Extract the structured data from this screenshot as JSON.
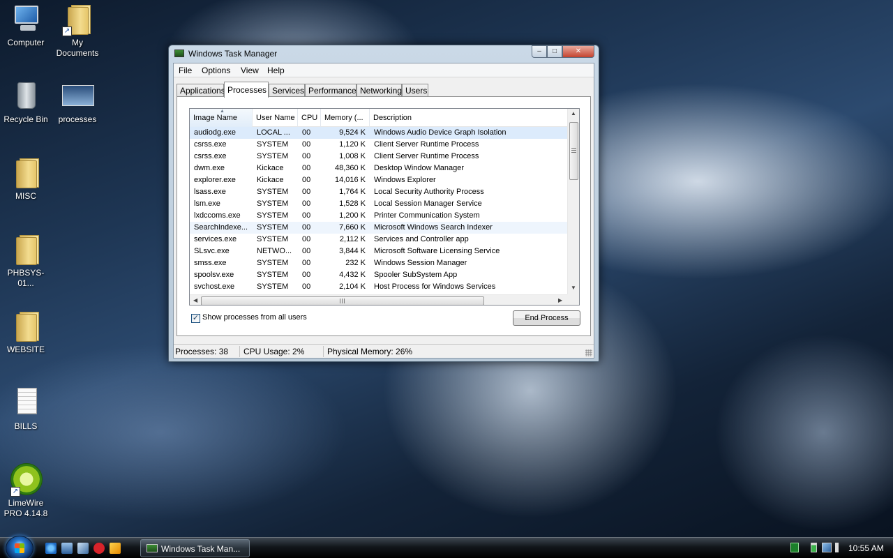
{
  "desktop": {
    "icons": [
      {
        "label": "Computer"
      },
      {
        "label": "My Documents"
      },
      {
        "label": "Recycle Bin"
      },
      {
        "label": "processes"
      },
      {
        "label": "MISC"
      },
      {
        "label": "PHBSYS-01..."
      },
      {
        "label": "WEBSITE"
      },
      {
        "label": "BILLS"
      },
      {
        "label": "LimeWire PRO 4.14.8"
      }
    ]
  },
  "window": {
    "title": "Windows Task Manager",
    "controls": {
      "minimize": "–",
      "maximize": "□",
      "close": "✕"
    },
    "menu": [
      "File",
      "Options",
      "View",
      "Help"
    ],
    "tabs": [
      "Applications",
      "Processes",
      "Services",
      "Performance",
      "Networking",
      "Users"
    ],
    "active_tab": "Processes",
    "columns": [
      "Image Name",
      "User Name",
      "CPU",
      "Memory (...",
      "Description"
    ],
    "sorted_column": "Image Name",
    "processes": [
      {
        "image": "audiodg.exe",
        "user": "LOCAL ...",
        "cpu": "00",
        "memory": "9,524 K",
        "description": "Windows Audio Device Graph Isolation"
      },
      {
        "image": "csrss.exe",
        "user": "SYSTEM",
        "cpu": "00",
        "memory": "1,120 K",
        "description": "Client Server Runtime Process"
      },
      {
        "image": "csrss.exe",
        "user": "SYSTEM",
        "cpu": "00",
        "memory": "1,008 K",
        "description": "Client Server Runtime Process"
      },
      {
        "image": "dwm.exe",
        "user": "Kickace",
        "cpu": "00",
        "memory": "48,360 K",
        "description": "Desktop Window Manager"
      },
      {
        "image": "explorer.exe",
        "user": "Kickace",
        "cpu": "00",
        "memory": "14,016 K",
        "description": "Windows Explorer"
      },
      {
        "image": "lsass.exe",
        "user": "SYSTEM",
        "cpu": "00",
        "memory": "1,764 K",
        "description": "Local Security Authority Process"
      },
      {
        "image": "lsm.exe",
        "user": "SYSTEM",
        "cpu": "00",
        "memory": "1,528 K",
        "description": "Local Session Manager Service"
      },
      {
        "image": "lxdccoms.exe",
        "user": "SYSTEM",
        "cpu": "00",
        "memory": "1,200 K",
        "description": "Printer Communication System"
      },
      {
        "image": "SearchIndexe...",
        "user": "SYSTEM",
        "cpu": "00",
        "memory": "7,660 K",
        "description": "Microsoft Windows Search Indexer"
      },
      {
        "image": "services.exe",
        "user": "SYSTEM",
        "cpu": "00",
        "memory": "2,112 K",
        "description": "Services and Controller app"
      },
      {
        "image": "SLsvc.exe",
        "user": "NETWO...",
        "cpu": "00",
        "memory": "3,844 K",
        "description": "Microsoft Software Licensing Service"
      },
      {
        "image": "smss.exe",
        "user": "SYSTEM",
        "cpu": "00",
        "memory": "232 K",
        "description": "Windows Session Manager"
      },
      {
        "image": "spoolsv.exe",
        "user": "SYSTEM",
        "cpu": "00",
        "memory": "4,432 K",
        "description": "Spooler SubSystem App"
      },
      {
        "image": "svchost.exe",
        "user": "SYSTEM",
        "cpu": "00",
        "memory": "2,104 K",
        "description": "Host Process for Windows Services"
      }
    ],
    "selected_row": 0,
    "hot_row": 8,
    "show_all_users": {
      "label": "Show processes from all users",
      "checked": true,
      "mark": "✓"
    },
    "end_process_label": "End Process",
    "status": {
      "processes": "Processes: 38",
      "cpu": "CPU Usage: 2%",
      "memory": "Physical Memory: 26%"
    }
  },
  "taskbar": {
    "quick_launch": [
      "internet-explorer-icon",
      "show-desktop-icon",
      "switch-windows-icon",
      "aim-icon",
      "media-player-icon"
    ],
    "task_button_label": "Windows Task Man...",
    "clock": "10:55 AM"
  },
  "colors": {
    "selection": "#dcebfc",
    "titlebar": "#cad9e7",
    "close_button": "#c4432e"
  }
}
